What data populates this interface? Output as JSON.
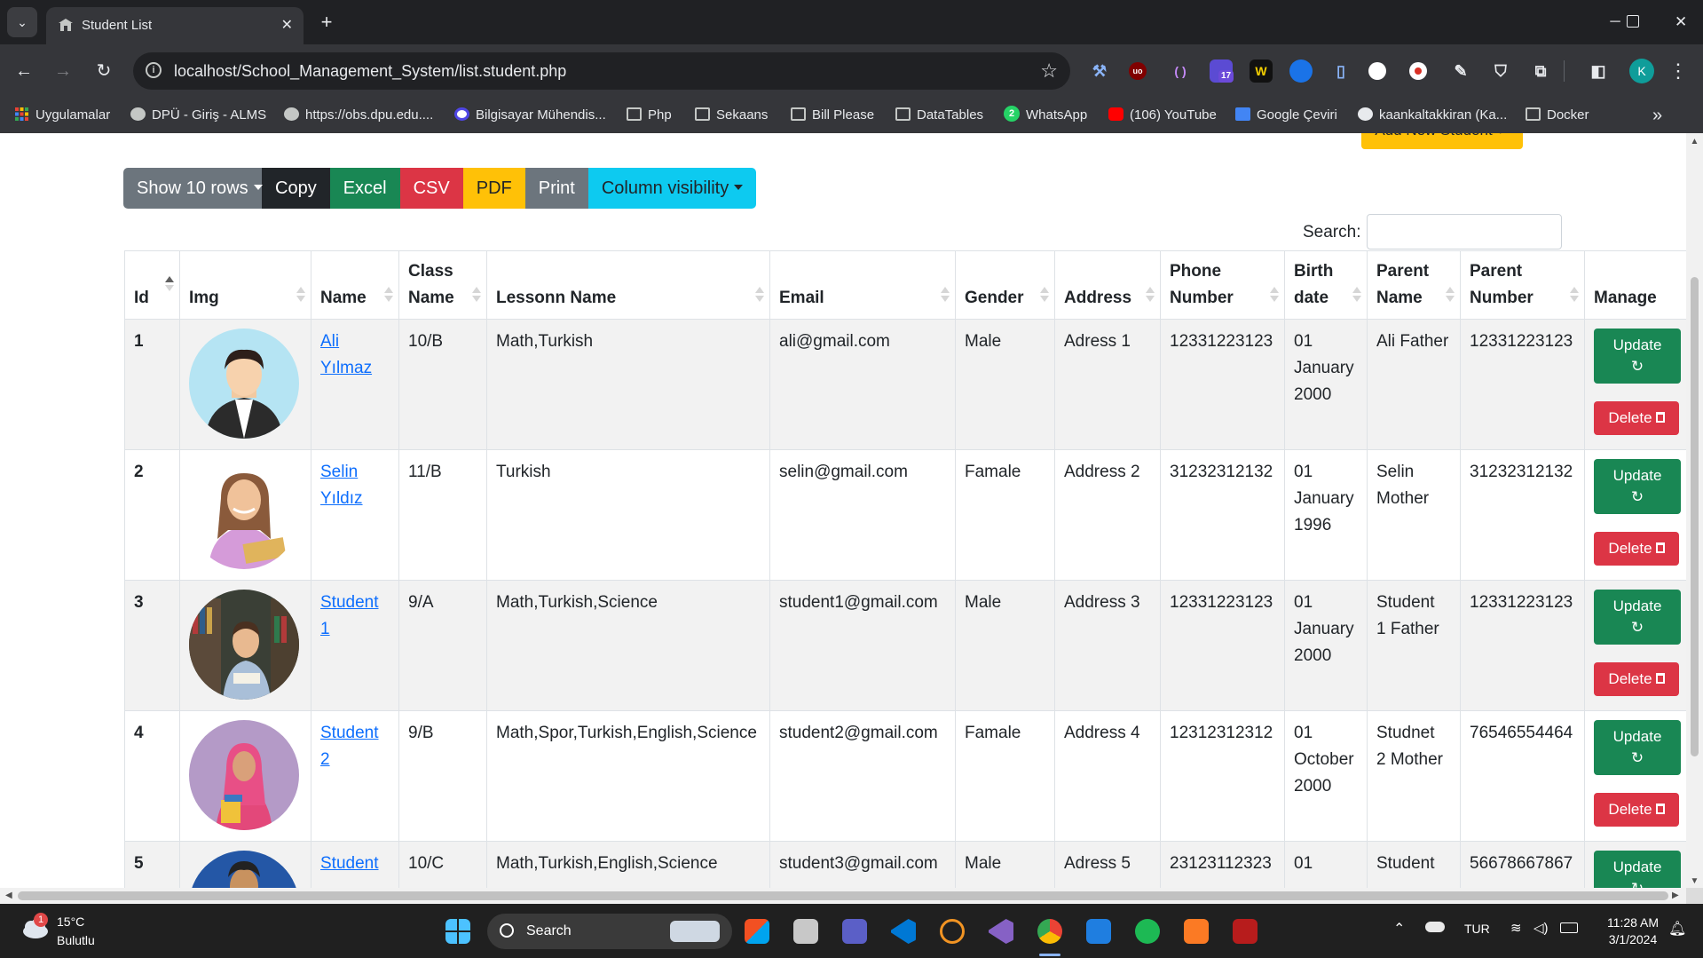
{
  "browser": {
    "tab_title": "Student List",
    "url": "localhost/School_Management_System/list.student.php",
    "bookmarks": [
      {
        "label": "Uygulamalar",
        "icon": "apps-grid-icon"
      },
      {
        "label": "DPÜ - Giriş - ALMS",
        "icon": "globe-icon"
      },
      {
        "label": "https://obs.dpu.edu....",
        "icon": "globe-icon"
      },
      {
        "label": "Bilgisayar Mühendis...",
        "icon": "info-icon"
      },
      {
        "label": "Php",
        "icon": "folder-icon"
      },
      {
        "label": "Sekaans",
        "icon": "folder-icon"
      },
      {
        "label": "Bill Please",
        "icon": "folder-icon"
      },
      {
        "label": "DataTables",
        "icon": "folder-icon"
      },
      {
        "label": "WhatsApp",
        "icon": "whatsapp-icon"
      },
      {
        "label": "(106) YouTube",
        "icon": "youtube-icon"
      },
      {
        "label": "Google Çeviri",
        "icon": "google-translate-icon"
      },
      {
        "label": "kaankaltakkiran (Ka...",
        "icon": "github-icon"
      },
      {
        "label": "Docker",
        "icon": "folder-icon"
      }
    ],
    "whatsapp_badge": "2",
    "extension_badge": "17",
    "profile_initial": "K"
  },
  "page": {
    "add_button": "Add New Student ✓",
    "buttons": {
      "show_rows": "Show 10 rows",
      "copy": "Copy",
      "excel": "Excel",
      "csv": "CSV",
      "pdf": "PDF",
      "print": "Print",
      "column_visibility": "Column visibility"
    },
    "search_label": "Search:",
    "search_value": ""
  },
  "table": {
    "headers": {
      "id": "Id",
      "img": "Img",
      "name": "Name",
      "class_line1": "Class",
      "class_line2": "Name",
      "lesson": "Lessonn Name",
      "email": "Email",
      "gender": "Gender",
      "address": "Address",
      "phone_line1": "Phone",
      "phone_line2": "Number",
      "birth_line1": "Birth",
      "birth_line2": "date",
      "pname_line1": "Parent",
      "pname_line2": "Name",
      "pnum_line1": "Parent",
      "pnum_line2": "Number",
      "manage": "Manage"
    },
    "update_label": "Update",
    "delete_label": "Delete",
    "rows": [
      {
        "id": "1",
        "name1": "Ali",
        "name2": "Yılmaz",
        "class": "10/B",
        "lessons": "Math,Turkish",
        "email": "ali@gmail.com",
        "gender": "Male",
        "address": "Adress 1",
        "phone": "12331223123",
        "birth1": "01",
        "birth2": "January",
        "birth3": "2000",
        "pname1": "Ali Father",
        "pname2": "",
        "pnum": "12331223123"
      },
      {
        "id": "2",
        "name1": "Selin",
        "name2": "Yıldız",
        "class": "11/B",
        "lessons": "Turkish",
        "email": "selin@gmail.com",
        "gender": "Famale",
        "address": "Address 2",
        "phone": "31232312132",
        "birth1": "01",
        "birth2": "January",
        "birth3": "1996",
        "pname1": "Selin",
        "pname2": "Mother",
        "pnum": "31232312132"
      },
      {
        "id": "3",
        "name1": "Student",
        "name2": "1",
        "class": "9/A",
        "lessons": "Math,Turkish,Science",
        "email": "student1@gmail.com",
        "gender": "Male",
        "address": "Address 3",
        "phone": "12331223123",
        "birth1": "01",
        "birth2": "January",
        "birth3": "2000",
        "pname1": "Student",
        "pname2": "1 Father",
        "pnum": "12331223123"
      },
      {
        "id": "4",
        "name1": "Student",
        "name2": "2",
        "class": "9/B",
        "lessons": "Math,Spor,Turkish,English,Science",
        "email": "student2@gmail.com",
        "gender": "Famale",
        "address": "Address 4",
        "phone": "12312312312",
        "birth1": "01",
        "birth2": "October",
        "birth3": "2000",
        "pname1": "Studnet",
        "pname2": "2 Mother",
        "pnum": "76546554464"
      },
      {
        "id": "5",
        "name1": "Student",
        "name2": "",
        "class": "10/C",
        "lessons": "Math,Turkish,English,Science",
        "email": "student3@gmail.com",
        "gender": "Male",
        "address": "Adress 5",
        "phone": "23123112323",
        "birth1": "01",
        "birth2": "",
        "birth3": "",
        "pname1": "Student",
        "pname2": "",
        "pnum": "56678667867"
      }
    ]
  },
  "taskbar": {
    "weather_temp": "15°C",
    "weather_desc": "Bulutlu",
    "weather_badge": "1",
    "search_label": "Search",
    "language": "TUR",
    "time": "11:28 AM",
    "date": "3/1/2024"
  },
  "colors": {
    "chrome_dark": "#202124",
    "chrome_toolbar": "#35363a",
    "success": "#198754",
    "danger": "#dc3545",
    "warning": "#ffc107",
    "info": "#0dcaf0",
    "secondary": "#6c757d",
    "link": "#0d6efd"
  }
}
